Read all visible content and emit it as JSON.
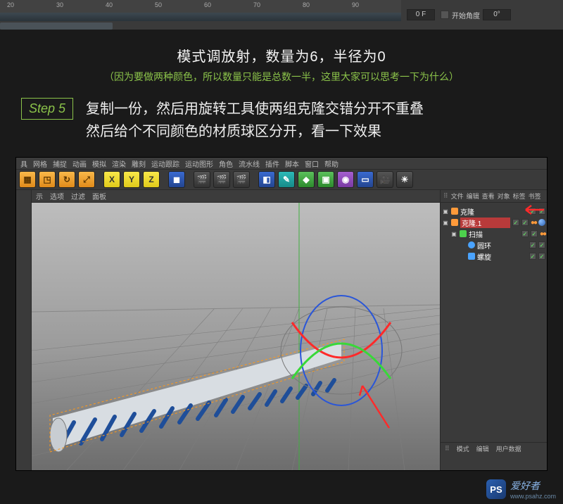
{
  "top": {
    "ticks": [
      "20",
      "30",
      "40",
      "50",
      "60",
      "70",
      "80",
      "90"
    ],
    "frame_value": "0 F",
    "start_angle_label": "开始角度",
    "start_angle_value": "0°"
  },
  "instruction": {
    "line1": "模式调放射，数量为6，半径为0",
    "line2": "（因为要做两种颜色，所以数量只能是总数一半，这里大家可以思考一下为什么）"
  },
  "step": {
    "badge": "Step 5",
    "line1": "复制一份，然后用旋转工具使两组克隆交错分开不重叠",
    "line2": "然后给个不同颜色的材质球区分开，看一下效果"
  },
  "app": {
    "menubar": [
      "具",
      "网格",
      "捕捉",
      "动画",
      "模拟",
      "渲染",
      "雕刻",
      "运动跟踪",
      "运动图形",
      "角色",
      "流水线",
      "插件",
      "脚本",
      "窗口",
      "帮助"
    ],
    "view_menu": [
      "示",
      "选项",
      "过滤",
      "面板"
    ],
    "toolbar_groups": {
      "orange": [
        "select-icon",
        "axis-icon",
        "rotate-icon",
        "scale-icon"
      ],
      "xyz": [
        "X",
        "Y",
        "Z"
      ],
      "cube": "cube-icon",
      "scene": [
        "clapper-1",
        "clapper-2",
        "clapper-3"
      ],
      "prims": [
        "cube",
        "brush",
        "poly",
        "tube",
        "group",
        "plane",
        "camera",
        "light"
      ]
    },
    "right_tabs": [
      "文件",
      "编辑",
      "查看",
      "对象",
      "标签",
      "书签"
    ],
    "tree": [
      {
        "indent": 0,
        "toggle": "+",
        "icon": "#ff9a3a",
        "label": "克隆",
        "checks": 2,
        "extra": ""
      },
      {
        "indent": 0,
        "toggle": "−",
        "icon": "#ff9a3a",
        "label": "克隆.1",
        "checks": 2,
        "extra": "dots-sphere"
      },
      {
        "indent": 1,
        "toggle": "−",
        "icon": "#4dd24d",
        "label": "扫描",
        "checks": 2,
        "extra": "dots"
      },
      {
        "indent": 2,
        "toggle": "",
        "icon": "#4aa3ff",
        "label": "圆环",
        "checks": 2,
        "extra": ""
      },
      {
        "indent": 2,
        "toggle": "",
        "icon": "#4aa3ff",
        "label": "螺旋",
        "checks": 2,
        "extra": ""
      }
    ],
    "bottom_tabs": [
      "模式",
      "编辑",
      "用户数据"
    ]
  },
  "watermark": {
    "badge": "PS",
    "text": "爱好者",
    "url": "www.psahz.com"
  }
}
